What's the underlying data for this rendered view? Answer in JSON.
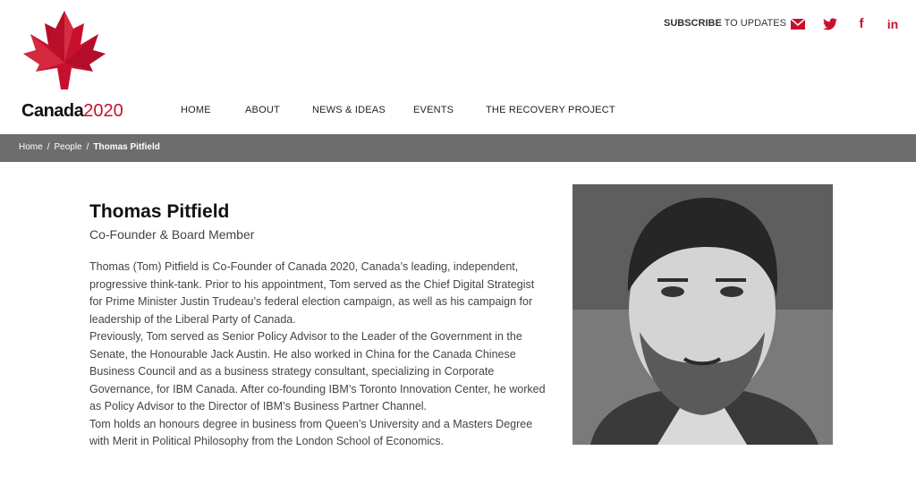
{
  "brand": {
    "word": "Canada",
    "year": "2020"
  },
  "header": {
    "subscribe_bold": "SUBSCRIBE",
    "subscribe_rest": " TO UPDATES",
    "social": [
      {
        "icon": "mail-icon",
        "glyph": "✉"
      },
      {
        "icon": "twitter-icon",
        "glyph": "🐦"
      },
      {
        "icon": "facebook-icon",
        "glyph": "f"
      },
      {
        "icon": "linkedin-icon",
        "glyph": "in"
      }
    ]
  },
  "nav": [
    "HOME",
    "ABOUT",
    "NEWS & IDEAS",
    "EVENTS",
    "THE RECOVERY PROJECT"
  ],
  "breadcrumb": {
    "home": "Home",
    "sep": "/",
    "section": "People",
    "current": "Thomas Pitfield"
  },
  "profile": {
    "name": "Thomas Pitfield",
    "role": "Co-Founder & Board Member",
    "bio": [
      "Thomas (Tom) Pitfield is Co-Founder of Canada 2020, Canada’s leading, independent, progressive think-tank. Prior to his appointment, Tom served as the Chief Digital Strategist for Prime Minister Justin Trudeau’s federal election campaign, as well as his campaign for leadership of the Liberal Party of Canada.",
      "Previously, Tom served as Senior Policy Advisor to the Leader of the Government in the Senate, the Honourable Jack Austin. He also worked in China for the Canada Chinese Business Council and as a business strategy consultant, specializing in Corporate Governance, for IBM Canada. After co-founding IBM’s Toronto Innovation Center, he worked as Policy Advisor to the Director of IBM’s Business Partner Channel.",
      "Tom holds an honours degree in business from Queen’s University and a Masters Degree with Merit in Political Philosophy from the London School of Economics."
    ]
  },
  "colors": {
    "brand_red": "#c8102e",
    "crumb_bar": "#6d6d6d"
  }
}
